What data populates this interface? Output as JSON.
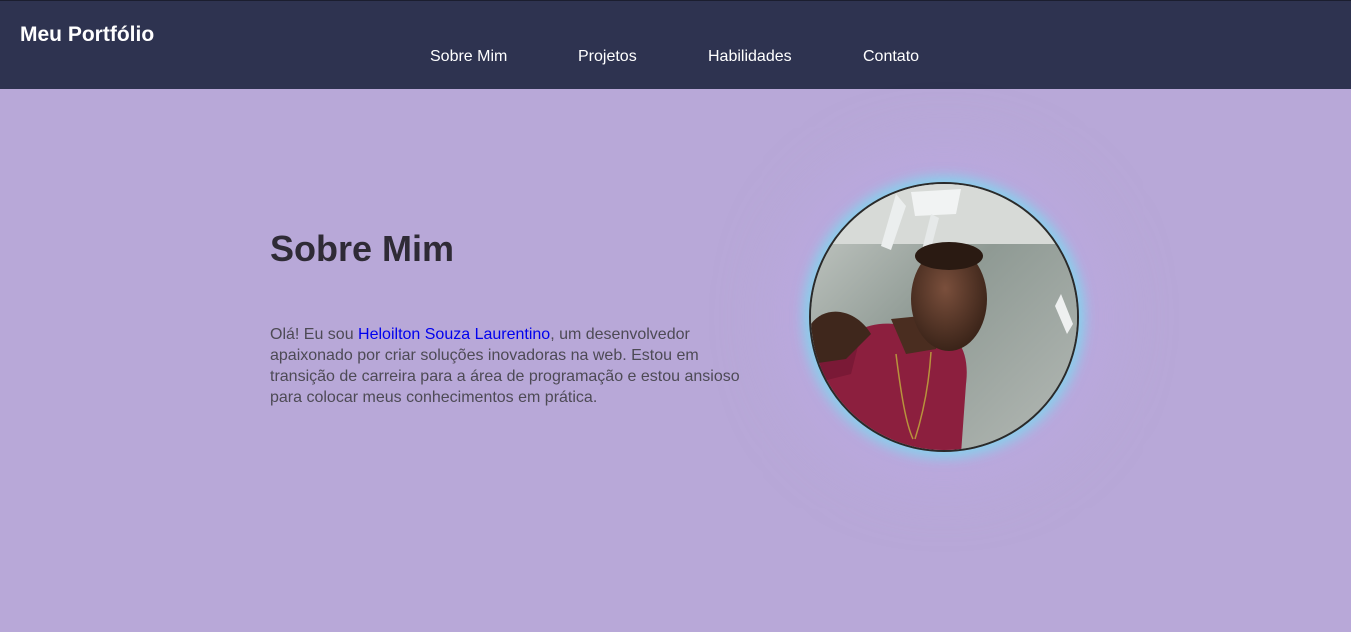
{
  "header": {
    "brand": "Meu Portfólio",
    "nav": [
      {
        "label": "Sobre Mim"
      },
      {
        "label": "Projetos"
      },
      {
        "label": "Habilidades"
      },
      {
        "label": "Contato"
      }
    ]
  },
  "about": {
    "title": "Sobre Mim",
    "text_before": "Olá! Eu sou ",
    "name": "Heloilton Souza Laurentino",
    "text_after": ", um desenvolvedor apaixonado por criar soluções inovadoras na web. Estou em transição de carreira para a área de programação e estou ansioso para colocar meus conhecimentos em prática."
  },
  "colors": {
    "header_bg": "#2e3350",
    "page_bg": "#b8a8d8",
    "name_link": "#0000ee",
    "avatar_glow": "#78dcf0"
  }
}
